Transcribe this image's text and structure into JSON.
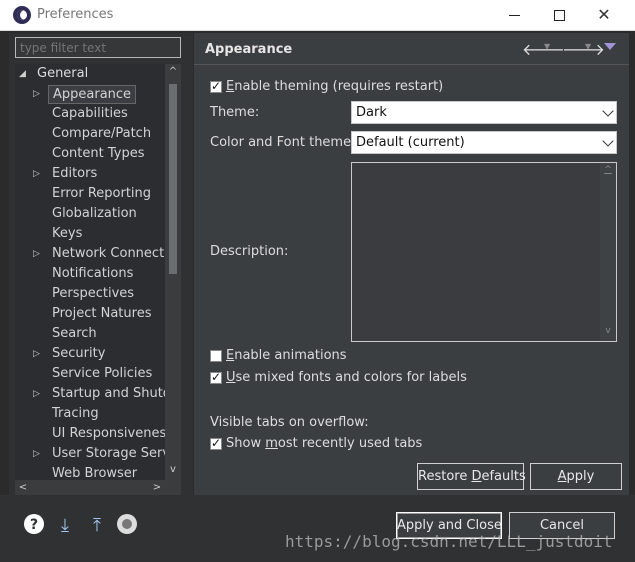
{
  "window": {
    "title": "Preferences",
    "minimize_label": "",
    "maximize_label": "",
    "close_label": "✕"
  },
  "left": {
    "filter_placeholder": "type filter text",
    "tree": [
      {
        "label": "General",
        "level": 0,
        "expand": "◢"
      },
      {
        "label": "Appearance",
        "level": 1,
        "expand": "▷",
        "selected": true
      },
      {
        "label": "Capabilities",
        "level": 1,
        "expand": ""
      },
      {
        "label": "Compare/Patch",
        "level": 1,
        "expand": ""
      },
      {
        "label": "Content Types",
        "level": 1,
        "expand": ""
      },
      {
        "label": "Editors",
        "level": 1,
        "expand": "▷"
      },
      {
        "label": "Error Reporting",
        "level": 1,
        "expand": ""
      },
      {
        "label": "Globalization",
        "level": 1,
        "expand": ""
      },
      {
        "label": "Keys",
        "level": 1,
        "expand": ""
      },
      {
        "label": "Network Connectio",
        "level": 1,
        "expand": "▷"
      },
      {
        "label": "Notifications",
        "level": 1,
        "expand": ""
      },
      {
        "label": "Perspectives",
        "level": 1,
        "expand": ""
      },
      {
        "label": "Project Natures",
        "level": 1,
        "expand": ""
      },
      {
        "label": "Search",
        "level": 1,
        "expand": ""
      },
      {
        "label": "Security",
        "level": 1,
        "expand": "▷"
      },
      {
        "label": "Service Policies",
        "level": 1,
        "expand": ""
      },
      {
        "label": "Startup and Shutdo",
        "level": 1,
        "expand": "▷"
      },
      {
        "label": "Tracing",
        "level": 1,
        "expand": ""
      },
      {
        "label": "UI Responsiveness",
        "level": 1,
        "expand": ""
      },
      {
        "label": "User Storage Servic",
        "level": 1,
        "expand": "▷"
      },
      {
        "label": "Web Browser",
        "level": 1,
        "expand": ""
      }
    ],
    "scroll_up": "^",
    "scroll_down": "v",
    "scroll_left": "<",
    "scroll_right": ">"
  },
  "page": {
    "title": "Appearance",
    "nav_back": "🡐",
    "nav_forward": "🡒",
    "nav_dropdown": "▼",
    "enable_theming": {
      "prefix": "",
      "accel": "E",
      "rest": "nable theming (requires restart)",
      "checked": true
    },
    "theme_label": "Theme:",
    "theme_value": "Dark",
    "color_font_label": "Color and Font theme:",
    "color_font_value": "Default (current)",
    "description_label": "Description:",
    "enable_animations": {
      "prefix": "",
      "accel": "E",
      "rest": "nable animations",
      "checked": false
    },
    "mixed_fonts": {
      "prefix": "",
      "accel": "U",
      "rest": "se mixed fonts and colors for labels",
      "checked": true
    },
    "visible_tabs_label": "Visible tabs on overflow:",
    "show_mru": {
      "prefix": "Show ",
      "accel": "m",
      "rest": "ost recently used tabs",
      "checked": true
    },
    "restore_defaults": {
      "prefix": "Restore ",
      "accel": "D",
      "rest": "efaults"
    },
    "apply": {
      "prefix": "",
      "accel": "A",
      "rest": "pply"
    }
  },
  "bottom": {
    "help_icon": "?",
    "import_icon": "⤓",
    "export_icon": "⤒",
    "apply_and_close": "Apply and Close",
    "cancel": "Cancel",
    "watermark": "https://blog.csdn.net/LLL_justdoit"
  },
  "colors": {
    "dialog_bg": "#3b3e41",
    "tree_bg": "#2b2d30",
    "accent": "#a094d6"
  }
}
